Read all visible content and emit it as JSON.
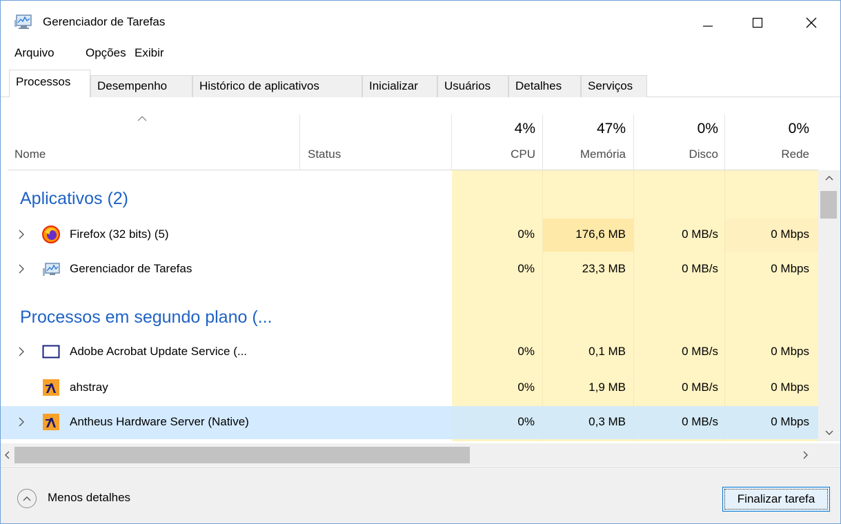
{
  "window": {
    "title": "Gerenciador de Tarefas",
    "controls": {
      "minimize": "minimize",
      "maximize": "maximize",
      "close": "close"
    }
  },
  "menu": [
    "Arquivo",
    "Opções",
    "Exibir"
  ],
  "tabs": [
    {
      "label": "Processos",
      "active": true
    },
    {
      "label": "Desempenho",
      "active": false
    },
    {
      "label": "Histórico de aplicativos",
      "active": false
    },
    {
      "label": "Inicializar",
      "active": false
    },
    {
      "label": "Usuários",
      "active": false
    },
    {
      "label": "Detalhes",
      "active": false
    },
    {
      "label": "Serviços",
      "active": false
    }
  ],
  "columns": {
    "name": "Nome",
    "status": "Status",
    "cpu": {
      "pct": "4%",
      "label": "CPU"
    },
    "memory": {
      "pct": "47%",
      "label": "Memória"
    },
    "disk": {
      "pct": "0%",
      "label": "Disco"
    },
    "network": {
      "pct": "0%",
      "label": "Rede"
    }
  },
  "groups": [
    {
      "title": "Aplicativos (2)",
      "rows": [
        {
          "name": "Firefox (32 bits) (5)",
          "icon": "firefox-icon",
          "expandable": true,
          "cpu": "0%",
          "memory": "176,6 MB",
          "disk": "0 MB/s",
          "network": "0 Mbps"
        },
        {
          "name": "Gerenciador de Tarefas",
          "icon": "task-manager-icon",
          "expandable": true,
          "cpu": "0%",
          "memory": "23,3 MB",
          "disk": "0 MB/s",
          "network": "0 Mbps"
        }
      ]
    },
    {
      "title": "Processos em segundo plano (...",
      "rows": [
        {
          "name": "Adobe Acrobat Update Service (...",
          "icon": "window-frame-icon",
          "expandable": true,
          "cpu": "0%",
          "memory": "0,1 MB",
          "disk": "0 MB/s",
          "network": "0 Mbps"
        },
        {
          "name": "ahstray",
          "icon": "antares-icon",
          "expandable": false,
          "cpu": "0%",
          "memory": "1,9 MB",
          "disk": "0 MB/s",
          "network": "0 Mbps"
        },
        {
          "name": "Antheus Hardware Server (Native)",
          "icon": "antares-icon",
          "expandable": true,
          "selected": true,
          "cpu": "0%",
          "memory": "0,3 MB",
          "disk": "0 MB/s",
          "network": "0 Mbps"
        }
      ]
    }
  ],
  "footer": {
    "less_details": "Menos detalhes",
    "end_task": "Finalizar tarefa"
  },
  "colors": {
    "group_title": "#1f62c4",
    "heat_light": "#fff4c4",
    "heat_medium": "#ffe9a9",
    "selection": "#cce8ff",
    "button_border": "#0078d7"
  }
}
